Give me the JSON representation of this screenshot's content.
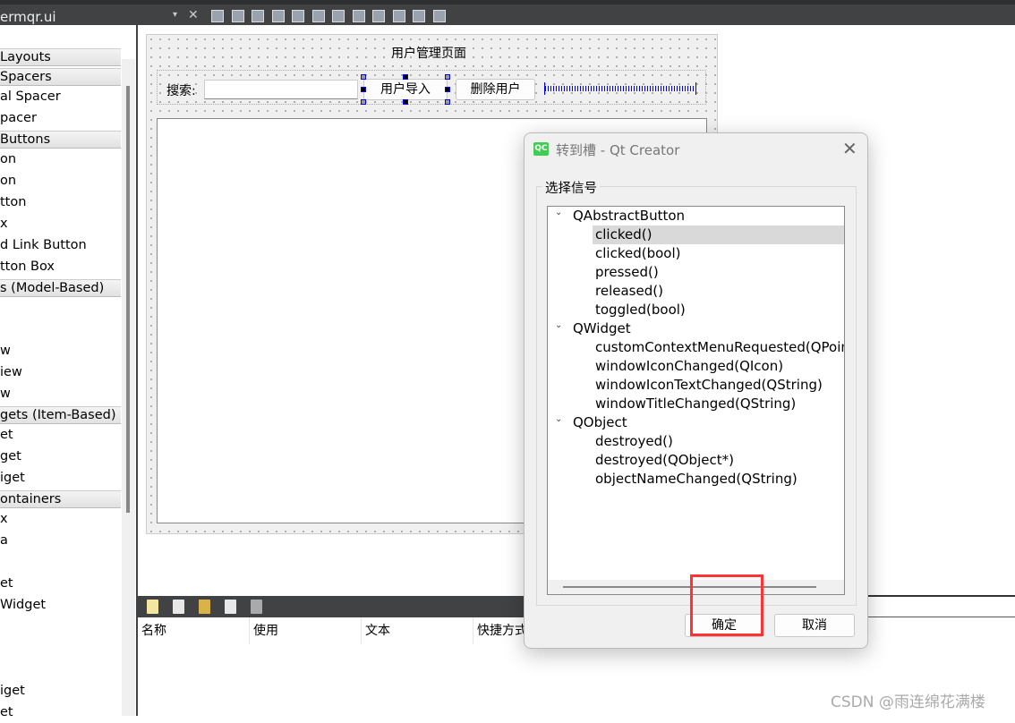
{
  "toolbar": {
    "file_name": "ermqr.ui",
    "combo_arrow": "▾",
    "close": "✕",
    "icons": [
      "edit-widgets-icon",
      "edit-signals-slots-icon",
      "edit-buddies-icon",
      "edit-tab-order-icon",
      "layout-horizontal-icon",
      "layout-vertical-icon",
      "layout-horizontal-splitter-icon",
      "layout-vertical-splitter-icon",
      "layout-form-icon",
      "layout-grid-icon",
      "break-layout-icon",
      "adjust-size-icon"
    ]
  },
  "sidebar": {
    "rows": [
      {
        "type": "h",
        "label": "Layouts"
      },
      {
        "type": "h",
        "label": "Spacers"
      },
      {
        "type": "i",
        "label": "al Spacer"
      },
      {
        "type": "i",
        "label": "pacer"
      },
      {
        "type": "h",
        "label": "Buttons"
      },
      {
        "type": "i",
        "label": "on"
      },
      {
        "type": "i",
        "label": "on"
      },
      {
        "type": "i",
        "label": "tton"
      },
      {
        "type": "i",
        "label": "x"
      },
      {
        "type": "i",
        "label": "d Link Button"
      },
      {
        "type": "i",
        "label": "tton Box"
      },
      {
        "type": "h",
        "label": "s (Model-Based)"
      },
      {
        "type": "i",
        "label": ""
      },
      {
        "type": "i",
        "label": ""
      },
      {
        "type": "i",
        "label": "w"
      },
      {
        "type": "i",
        "label": "iew"
      },
      {
        "type": "i",
        "label": "w"
      },
      {
        "type": "h",
        "label": "gets (Item-Based)"
      },
      {
        "type": "i",
        "label": "et"
      },
      {
        "type": "i",
        "label": "get"
      },
      {
        "type": "i",
        "label": "iget"
      },
      {
        "type": "h",
        "label": "ontainers"
      },
      {
        "type": "i",
        "label": "x"
      },
      {
        "type": "i",
        "label": "a"
      },
      {
        "type": "i",
        "label": ""
      },
      {
        "type": "i",
        "label": "et"
      },
      {
        "type": "i",
        "label": "Widget"
      },
      {
        "type": "i",
        "label": ""
      },
      {
        "type": "i",
        "label": ""
      },
      {
        "type": "i",
        "label": ""
      },
      {
        "type": "i",
        "label": "iget"
      },
      {
        "type": "i",
        "label": "et"
      }
    ]
  },
  "form": {
    "title": "用户管理页面",
    "search_label": "搜索:",
    "search_value": "",
    "import_button": "用户导入",
    "delete_button": "删除用户"
  },
  "action_editor": {
    "icons": [
      "new-action-icon",
      "copy-action-icon",
      "paste-action-icon",
      "delete-action-icon",
      "settings-wrench-icon"
    ],
    "columns": [
      "名称",
      "使用",
      "文本",
      "快捷方式"
    ]
  },
  "dialog": {
    "icon_text": "QC",
    "title": "转到槽 - Qt Creator",
    "close": "✕",
    "group_label": "选择信号",
    "tree": [
      {
        "level": 0,
        "label": "QAbstractButton"
      },
      {
        "level": 1,
        "label": "clicked()",
        "selected": true
      },
      {
        "level": 1,
        "label": "clicked(bool)"
      },
      {
        "level": 1,
        "label": "pressed()"
      },
      {
        "level": 1,
        "label": "released()"
      },
      {
        "level": 1,
        "label": "toggled(bool)"
      },
      {
        "level": 0,
        "label": "QWidget"
      },
      {
        "level": 1,
        "label": "customContextMenuRequested(QPoint)"
      },
      {
        "level": 1,
        "label": "windowIconChanged(QIcon)"
      },
      {
        "level": 1,
        "label": "windowIconTextChanged(QString)"
      },
      {
        "level": 1,
        "label": "windowTitleChanged(QString)"
      },
      {
        "level": 0,
        "label": "QObject"
      },
      {
        "level": 1,
        "label": "destroyed()"
      },
      {
        "level": 1,
        "label": "destroyed(QObject*)"
      },
      {
        "level": 1,
        "label": "objectNameChanged(QString)"
      }
    ],
    "ok": "确定",
    "cancel": "取消",
    "highlight_color": "#ff3333"
  },
  "watermark": "CSDN @雨连绵花满楼"
}
